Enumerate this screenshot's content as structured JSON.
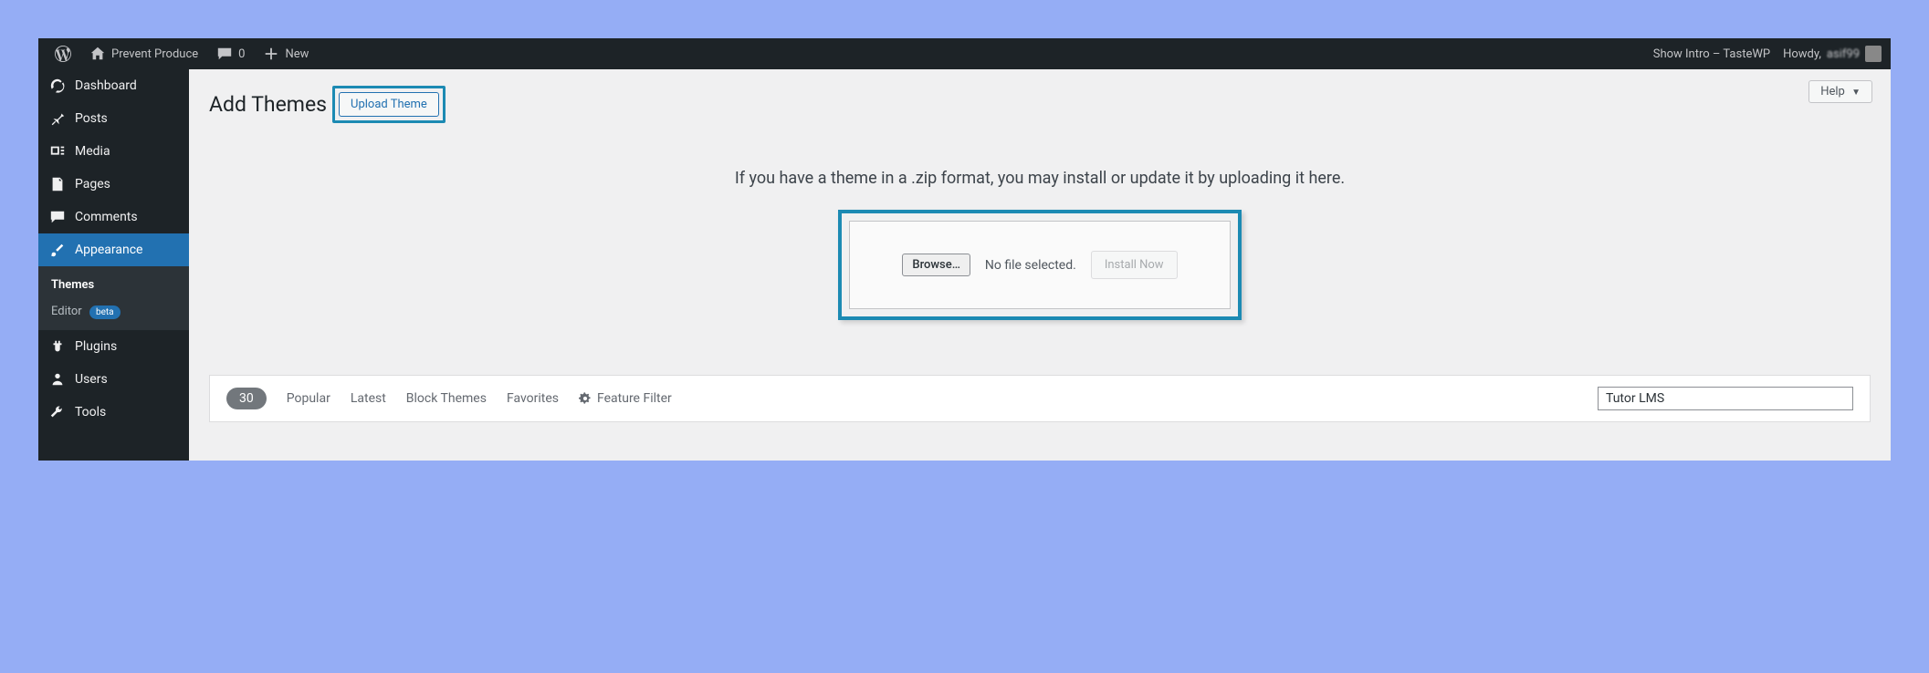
{
  "topbar": {
    "site_name": "Prevent Produce",
    "comments_count": "0",
    "new_label": "New",
    "show_intro": "Show Intro – TasteWP",
    "howdy": "Howdy,",
    "username": "asif99"
  },
  "sidebar": {
    "items": [
      {
        "icon": "dashboard",
        "label": "Dashboard"
      },
      {
        "icon": "pin",
        "label": "Posts"
      },
      {
        "icon": "media",
        "label": "Media"
      },
      {
        "icon": "page",
        "label": "Pages"
      },
      {
        "icon": "comment",
        "label": "Comments"
      },
      {
        "icon": "brush",
        "label": "Appearance",
        "active": true
      },
      {
        "icon": "plugin",
        "label": "Plugins"
      },
      {
        "icon": "user",
        "label": "Users"
      },
      {
        "icon": "wrench",
        "label": "Tools"
      }
    ],
    "submenu": {
      "themes": "Themes",
      "editor": "Editor",
      "editor_badge": "beta"
    }
  },
  "content": {
    "help_label": "Help",
    "page_title": "Add Themes",
    "upload_theme_btn": "Upload Theme",
    "upload_hint": "If you have a theme in a .zip format, you may install or update it by uploading it here.",
    "browse_btn": "Browse…",
    "file_status": "No file selected.",
    "install_btn": "Install Now"
  },
  "filter": {
    "count": "30",
    "tabs": [
      "Popular",
      "Latest",
      "Block Themes",
      "Favorites"
    ],
    "feature_filter": "Feature Filter",
    "search_value": "Tutor LMS"
  }
}
